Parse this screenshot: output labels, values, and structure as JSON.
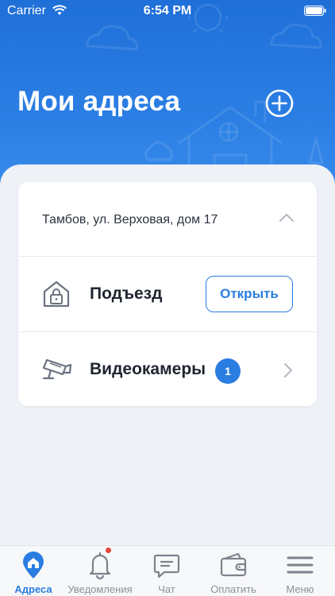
{
  "status_bar": {
    "carrier": "Carrier",
    "time": "6:54 PM"
  },
  "header": {
    "title": "Мои адреса",
    "add_icon": "plus-circle-icon"
  },
  "address_card": {
    "address": "Тамбов, ул. Верховая, дом 17",
    "entrance": {
      "label": "Подъезд",
      "open_button": "Открыть",
      "icon": "house-lock-icon"
    },
    "cameras": {
      "label": "Видеокамеры",
      "count": "1",
      "icon": "camera-icon"
    }
  },
  "tabbar": {
    "items": [
      {
        "label": "Адреса",
        "icon": "home-pin-icon",
        "active": true
      },
      {
        "label": "Уведомления",
        "icon": "bell-icon",
        "active": false
      },
      {
        "label": "Чат",
        "icon": "chat-icon",
        "active": false
      },
      {
        "label": "Оплатить",
        "icon": "wallet-icon",
        "active": false
      },
      {
        "label": "Меню",
        "icon": "menu-icon",
        "active": false
      }
    ]
  },
  "colors": {
    "accent": "#2a7de1",
    "header_bg": "#2478de",
    "background": "#eef1f6",
    "notification_dot": "#e8453c"
  }
}
